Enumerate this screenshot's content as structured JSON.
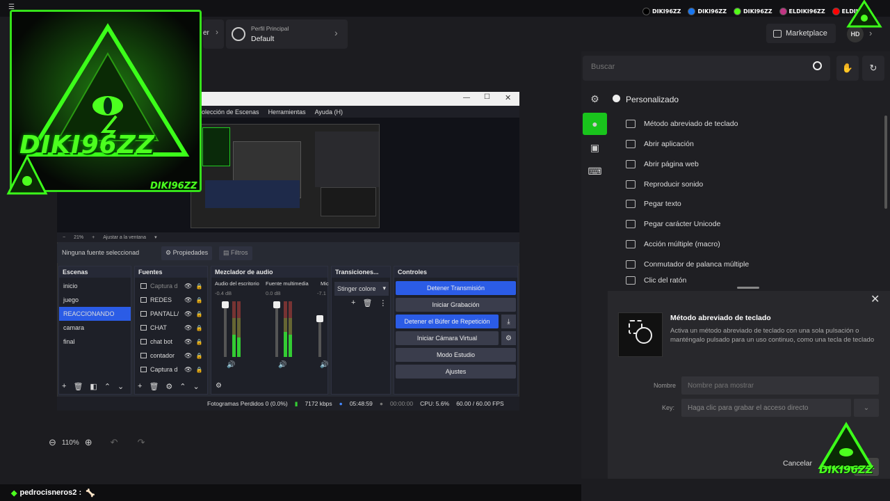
{
  "socials": [
    {
      "label": "DIKI96ZZ",
      "color": "#000000",
      "icon": "tiktok-icon"
    },
    {
      "label": "DIKI96ZZ",
      "color": "#1877f2",
      "icon": "facebook-icon"
    },
    {
      "label": "DIKI96ZZ",
      "color": "#53fc18",
      "icon": "kick-icon"
    },
    {
      "label": "ELDIKI96ZZ",
      "color": "#c13584",
      "icon": "instagram-icon"
    },
    {
      "label": "ELDIKI",
      "color": "#ff0000",
      "icon": "youtube-icon"
    }
  ],
  "header": {
    "prev_crumb": "er",
    "profile_label": "Perfil Principal",
    "profile_value": "Default",
    "marketplace": "Marketplace",
    "avatar": "HD"
  },
  "search": {
    "placeholder": "Buscar"
  },
  "category": {
    "title": "Personalizado"
  },
  "actions": [
    "Método abreviado de teclado",
    "Abrir aplicación",
    "Abrir página web",
    "Reproducir sonido",
    "Pegar texto",
    "Pegar carácter Unicode",
    "Acción múltiple (macro)",
    "Conmutador de palanca múltiple",
    "Clic del ratón"
  ],
  "detail": {
    "title": "Método abreviado de teclado",
    "desc": "Activa un método abreviado de teclado con una sola pulsación o manténgalo pulsado para un uso continuo, como una tecla de teclado",
    "name_label": "Nombre",
    "name_placeholder": "Nombre para mostrar",
    "key_label": "Key:",
    "key_placeholder": "Haga clic para grabar el acceso directo",
    "cancel": "Cancelar"
  },
  "obs": {
    "menu": [
      "olección de Escenas",
      "Herramientas",
      "Ayuda (H)"
    ],
    "zoom": [
      "−",
      "21%",
      "+",
      "Ajustar a la ventana"
    ],
    "no_source": "Ninguna fuente seleccionad",
    "properties": "Propiedades",
    "filters": "Filtros",
    "docks": {
      "scenes": "Escenas",
      "sources": "Fuentes",
      "mixer": "Mezclador de audio",
      "transitions": "Transiciones...",
      "controls": "Controles"
    },
    "scenes": [
      "inicio",
      "juego",
      "REACCIONANDO",
      "camara",
      "final"
    ],
    "sources": [
      "Captura d",
      "REDES",
      "PANTALL/",
      "CHAT",
      "chat bot",
      "contador",
      "Captura d"
    ],
    "mixer": {
      "ch1": "Audio del escritorio",
      "ch1_db": "-0.4 dB",
      "ch2": "Fuente multimedia",
      "ch2_db": "0.0 dB",
      "ch3": "Mic",
      "ch3_db": "-7.1"
    },
    "transition": "Stinger colore",
    "controls": [
      {
        "label": "Detener Transmisión",
        "blue": true
      },
      {
        "label": "Iniciar Grabación",
        "blue": false
      },
      {
        "label": "Detener el Búfer de Repetición",
        "blue": true
      },
      {
        "label": "Iniciar Cámara Virtual",
        "blue": false
      },
      {
        "label": "Modo Estudio",
        "blue": false
      },
      {
        "label": "Ajustes",
        "blue": false
      }
    ],
    "status": {
      "dropped": "Fotogramas Perdidos 0 (0.0%)",
      "bitrate": "7172 kbps",
      "stream_time": "05:48:59",
      "rec_time": "00:00:00",
      "cpu": "CPU: 5.6%",
      "fps": "60.00 / 60.00 FPS"
    }
  },
  "canvas_zoom": "110%",
  "chat": {
    "user": "pedrocisneros2 :",
    "message": "🦴"
  },
  "logo": {
    "text": "DIKI96ZZ",
    "sub": "DIKI96ZZ"
  }
}
